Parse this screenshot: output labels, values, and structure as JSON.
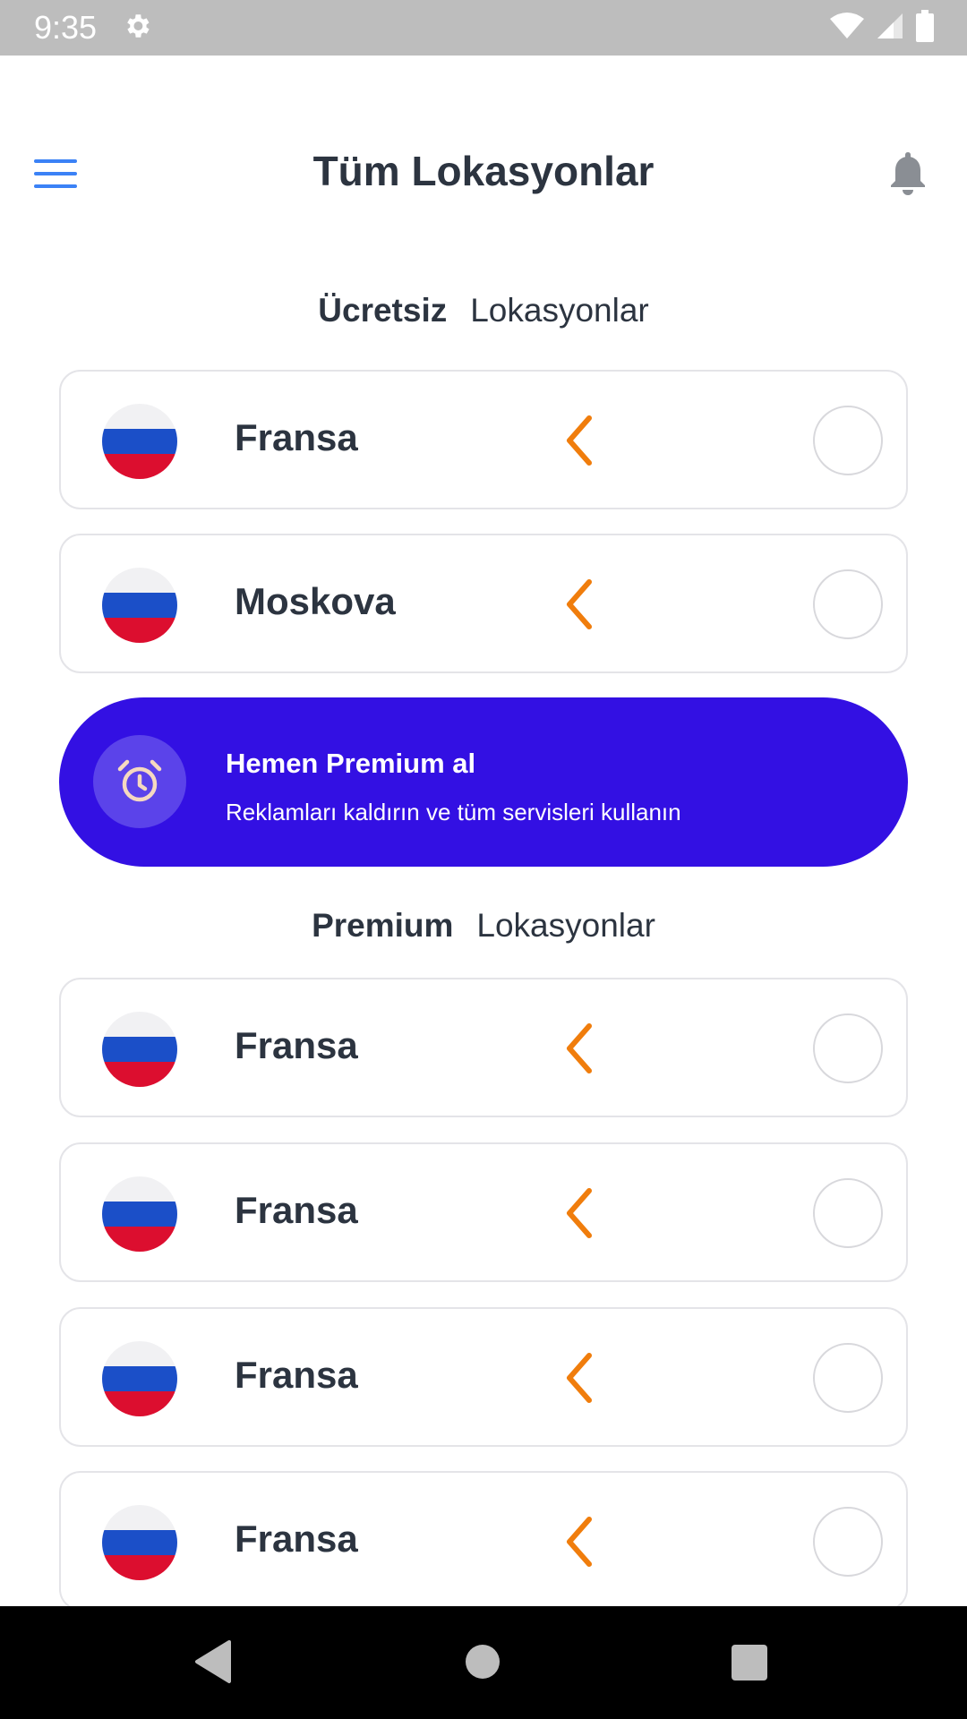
{
  "status_bar": {
    "time": "9:35",
    "icons": [
      "settings-icon",
      "wifi-icon",
      "signal-icon",
      "battery-icon"
    ]
  },
  "header": {
    "title": "Tüm Lokasyonlar",
    "menu_icon": "hamburger-menu-icon",
    "notification_icon": "bell-icon"
  },
  "free_section": {
    "heading_bold": "Ücretsiz",
    "heading_rest": "Lokasyonlar",
    "locations": [
      {
        "name": "Fransa",
        "flag": "russia-flag-icon"
      },
      {
        "name": "Moskova",
        "flag": "russia-flag-icon"
      }
    ]
  },
  "premium_banner": {
    "title": "Hemen Premium al",
    "subtitle": "Reklamları kaldırın ve tüm servisleri kullanın",
    "icon": "alarm-clock-icon"
  },
  "premium_section": {
    "heading_bold": "Premium",
    "heading_rest": "Lokasyonlar",
    "locations": [
      {
        "name": "Fransa",
        "flag": "russia-flag-icon"
      },
      {
        "name": "Fransa",
        "flag": "russia-flag-icon"
      },
      {
        "name": "Fransa",
        "flag": "russia-flag-icon"
      },
      {
        "name": "Fransa",
        "flag": "russia-flag-icon"
      }
    ]
  },
  "nav_bar": {
    "buttons": [
      "back-icon",
      "home-icon",
      "recents-icon"
    ]
  },
  "colors": {
    "accent_blue": "#3b82f6",
    "banner": "#3310e3",
    "chevron": "#f07d0c",
    "text_dark": "#2c3440"
  }
}
